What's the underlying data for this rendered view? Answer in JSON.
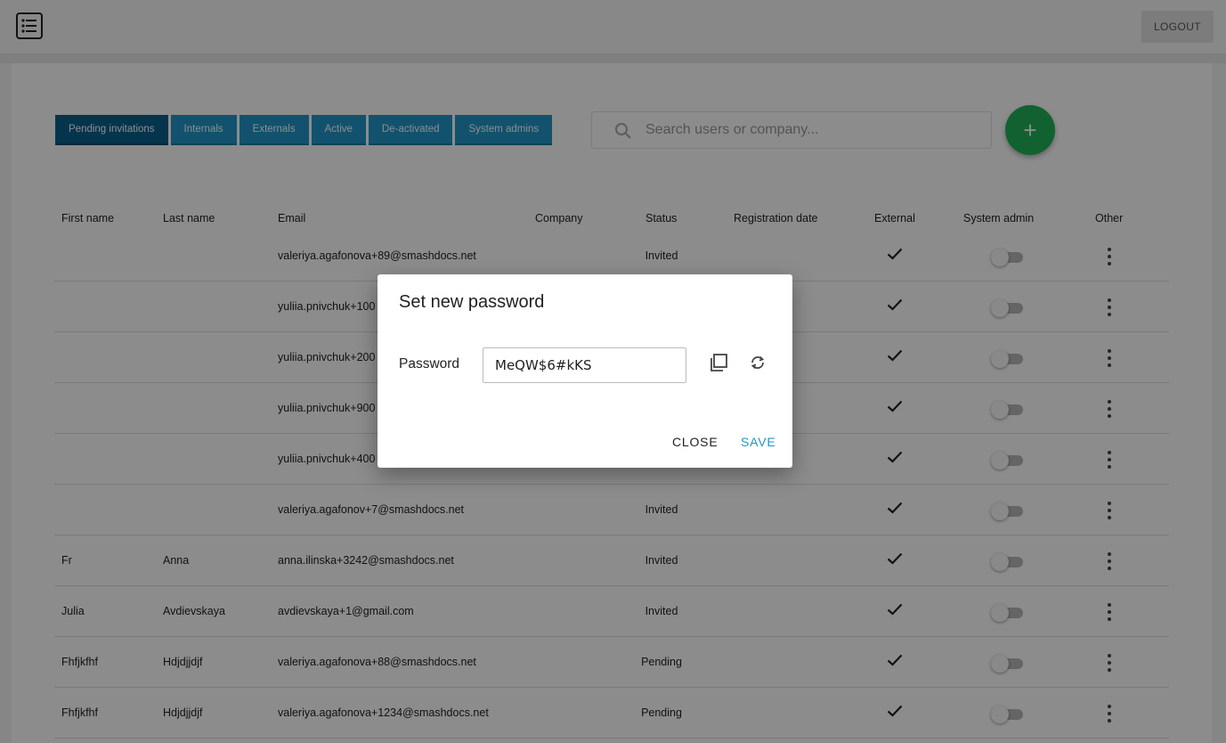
{
  "header": {
    "logout_label": "LOGOUT"
  },
  "tabs": [
    {
      "label": "Pending invitations",
      "active": true
    },
    {
      "label": "Internals",
      "active": false
    },
    {
      "label": "Externals",
      "active": false
    },
    {
      "label": "Active",
      "active": false
    },
    {
      "label": "De-activated",
      "active": false
    },
    {
      "label": "System admins",
      "active": false
    }
  ],
  "search": {
    "placeholder": "Search users or company..."
  },
  "add_button": {
    "label": "+"
  },
  "table": {
    "columns": [
      "First name",
      "Last name",
      "Email",
      "Company",
      "Status",
      "Registration date",
      "External",
      "System admin",
      "Other"
    ],
    "rows": [
      {
        "first": "",
        "last": "",
        "email": "valeriya.agafonova+89@smashdocs.net",
        "company": "",
        "status": "Invited",
        "reg_date": "",
        "external": true,
        "sysadmin": false
      },
      {
        "first": "",
        "last": "",
        "email": "yuliia.pnivchuk+100",
        "company": "",
        "status": "",
        "reg_date": "",
        "external": true,
        "sysadmin": false
      },
      {
        "first": "",
        "last": "",
        "email": "yuliia.pnivchuk+200",
        "company": "",
        "status": "",
        "reg_date": "",
        "external": true,
        "sysadmin": false
      },
      {
        "first": "",
        "last": "",
        "email": "yuliia.pnivchuk+900",
        "company": "",
        "status": "",
        "reg_date": "",
        "external": true,
        "sysadmin": false
      },
      {
        "first": "",
        "last": "",
        "email": "yuliia.pnivchuk+400",
        "company": "",
        "status": "",
        "reg_date": "",
        "external": true,
        "sysadmin": false
      },
      {
        "first": "",
        "last": "",
        "email": "valeriya.agafonov+7@smashdocs.net",
        "company": "",
        "status": "Invited",
        "reg_date": "",
        "external": true,
        "sysadmin": false
      },
      {
        "first": "Fr",
        "last": "Anna",
        "email": "anna.ilinska+3242@smashdocs.net",
        "company": "",
        "status": "Invited",
        "reg_date": "",
        "external": true,
        "sysadmin": false
      },
      {
        "first": "Julia",
        "last": "Avdievskaya",
        "email": "avdievskaya+1@gmail.com",
        "company": "",
        "status": "Invited",
        "reg_date": "",
        "external": true,
        "sysadmin": false
      },
      {
        "first": "Fhfjkfhf",
        "last": "Hdjdjjdjf",
        "email": "valeriya.agafonova+88@smashdocs.net",
        "company": "",
        "status": "Pending",
        "reg_date": "",
        "external": true,
        "sysadmin": false
      },
      {
        "first": "Fhfjkfhf",
        "last": "Hdjdjjdjf",
        "email": "valeriya.agafonova+1234@smashdocs.net",
        "company": "",
        "status": "Pending",
        "reg_date": "",
        "external": true,
        "sysadmin": false
      }
    ]
  },
  "dialog": {
    "title": "Set new password",
    "password_label": "Password",
    "password_value": "MeQW$6#kKS",
    "close_label": "CLOSE",
    "save_label": "SAVE"
  },
  "colors": {
    "tab": "#2196c8",
    "tab_active": "#0a5f8d",
    "fab": "#21b35a",
    "save": "#2196c8"
  }
}
